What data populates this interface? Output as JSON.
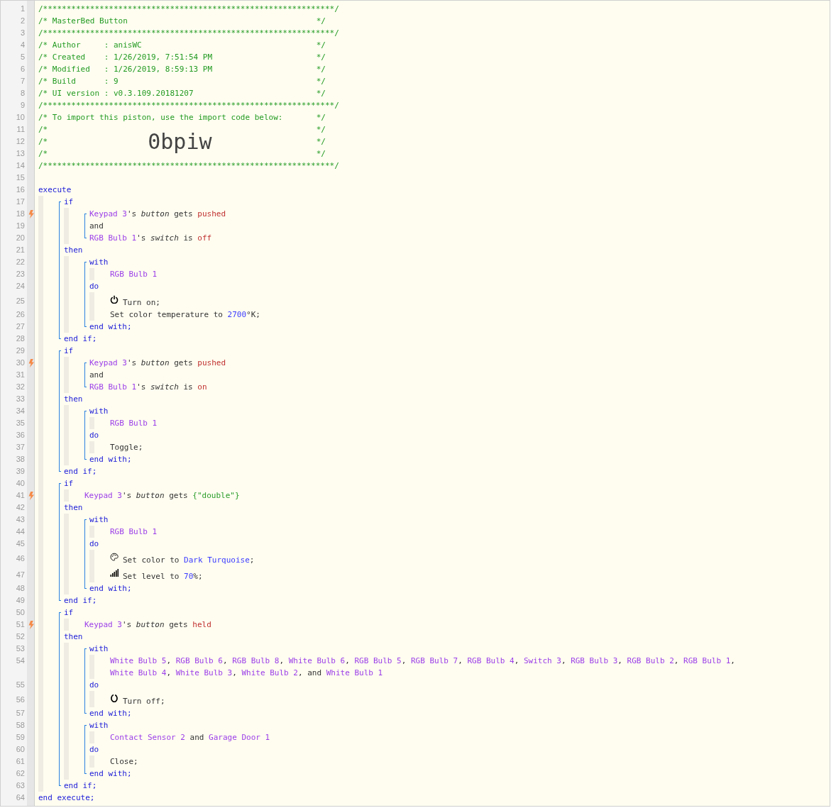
{
  "lines": [
    {
      "kind": "line",
      "number": "1",
      "trigger": false,
      "segments": [
        {
          "kind": "comment",
          "text": "/**************************************************************/"
        }
      ]
    },
    {
      "kind": "line",
      "number": "2",
      "trigger": false,
      "segments": [
        {
          "kind": "comment",
          "text": "/* MasterBed Button"
        },
        {
          "kind": "comment-end",
          "text": "*/"
        }
      ]
    },
    {
      "kind": "line",
      "number": "3",
      "trigger": false,
      "segments": [
        {
          "kind": "comment",
          "text": "/**************************************************************/"
        }
      ]
    },
    {
      "kind": "line",
      "number": "4",
      "trigger": false,
      "segments": [
        {
          "kind": "comment",
          "text": "/* Author     : anisWC"
        },
        {
          "kind": "comment-end",
          "text": "*/"
        }
      ]
    },
    {
      "kind": "line",
      "number": "5",
      "trigger": false,
      "segments": [
        {
          "kind": "comment",
          "text": "/* Created    : 1/26/2019, 7:51:54 PM"
        },
        {
          "kind": "comment-end",
          "text": "*/"
        }
      ]
    },
    {
      "kind": "line",
      "number": "6",
      "trigger": false,
      "segments": [
        {
          "kind": "comment",
          "text": "/* Modified   : 1/26/2019, 8:59:13 PM"
        },
        {
          "kind": "comment-end",
          "text": "*/"
        }
      ]
    },
    {
      "kind": "line",
      "number": "7",
      "trigger": false,
      "segments": [
        {
          "kind": "comment",
          "text": "/* Build      : 9"
        },
        {
          "kind": "comment-end",
          "text": "*/"
        }
      ]
    },
    {
      "kind": "line",
      "number": "8",
      "trigger": false,
      "segments": [
        {
          "kind": "comment",
          "text": "/* UI version : v0.3.109.20181207"
        },
        {
          "kind": "comment-end",
          "text": "*/"
        }
      ]
    },
    {
      "kind": "line",
      "number": "9",
      "trigger": false,
      "segments": [
        {
          "kind": "comment",
          "text": "/**************************************************************/"
        }
      ]
    },
    {
      "kind": "line",
      "number": "10",
      "trigger": false,
      "segments": [
        {
          "kind": "comment",
          "text": "/* To import this piston, use the import code below:"
        },
        {
          "kind": "comment-end",
          "text": "*/"
        }
      ]
    },
    {
      "kind": "line",
      "number": "11",
      "trigger": false,
      "segments": [
        {
          "kind": "comment",
          "text": "/*"
        },
        {
          "kind": "comment-end",
          "text": "*/"
        }
      ]
    },
    {
      "kind": "line",
      "number": "12",
      "trigger": false,
      "segments": [
        {
          "kind": "comment",
          "text": "/*"
        },
        {
          "kind": "import-code",
          "text": "0bpiw"
        },
        {
          "kind": "comment-end",
          "text": "*/"
        }
      ]
    },
    {
      "kind": "line",
      "number": "13",
      "trigger": false,
      "segments": [
        {
          "kind": "comment",
          "text": "/*"
        },
        {
          "kind": "comment-end",
          "text": "*/"
        }
      ]
    },
    {
      "kind": "line",
      "number": "14",
      "trigger": false,
      "segments": [
        {
          "kind": "comment",
          "text": "/**************************************************************/"
        }
      ]
    },
    {
      "kind": "line",
      "number": "15",
      "trigger": false
    },
    {
      "kind": "line",
      "number": "16",
      "trigger": false,
      "segments": [
        {
          "kind": "keyword",
          "text": "execute"
        }
      ],
      "children": [
        {
          "kind": "group",
          "items": [
            {
              "kind": "line",
              "number": "17",
              "trigger": false,
              "segments": [
                {
                  "kind": "keyword",
                  "text": "if"
                }
              ],
              "children": [
                {
                  "kind": "group",
                  "items": [
                    {
                      "kind": "line",
                      "number": "18",
                      "trigger": true,
                      "segments": [
                        {
                          "kind": "device",
                          "text": "Keypad 3"
                        },
                        {
                          "kind": "plain",
                          "text": "'s "
                        },
                        {
                          "kind": "property",
                          "text": "button"
                        },
                        {
                          "kind": "plain",
                          "text": " gets "
                        },
                        {
                          "kind": "value",
                          "text": "pushed"
                        }
                      ]
                    },
                    {
                      "kind": "line",
                      "number": "19",
                      "trigger": false,
                      "segments": [
                        {
                          "kind": "plain",
                          "text": "and"
                        }
                      ]
                    },
                    {
                      "kind": "line",
                      "number": "20",
                      "trigger": false,
                      "segments": [
                        {
                          "kind": "device",
                          "text": "RGB Bulb 1"
                        },
                        {
                          "kind": "plain",
                          "text": "'s "
                        },
                        {
                          "kind": "property",
                          "text": "switch"
                        },
                        {
                          "kind": "plain",
                          "text": " is "
                        },
                        {
                          "kind": "value",
                          "text": "off"
                        }
                      ]
                    }
                  ]
                }
              ]
            },
            {
              "kind": "line",
              "number": "21",
              "trigger": false,
              "segments": [
                {
                  "kind": "keyword",
                  "text": "then"
                }
              ],
              "children": [
                {
                  "kind": "group",
                  "items": [
                    {
                      "kind": "line",
                      "number": "22",
                      "trigger": false,
                      "segments": [
                        {
                          "kind": "keyword",
                          "text": "with"
                        }
                      ],
                      "children": [
                        {
                          "kind": "line",
                          "number": "23",
                          "trigger": false,
                          "segments": [
                            {
                              "kind": "device",
                              "text": "RGB Bulb 1"
                            }
                          ]
                        }
                      ]
                    },
                    {
                      "kind": "line",
                      "number": "24",
                      "trigger": false,
                      "segments": [
                        {
                          "kind": "keyword",
                          "text": "do"
                        }
                      ],
                      "children": [
                        {
                          "kind": "line",
                          "number": "25",
                          "trigger": false,
                          "segments": [
                            {
                              "kind": "power"
                            },
                            {
                              "kind": "plain",
                              "text": "Turn on;"
                            }
                          ]
                        },
                        {
                          "kind": "line",
                          "number": "26",
                          "trigger": false,
                          "segments": [
                            {
                              "kind": "plain",
                              "text": "Set color temperature to "
                            },
                            {
                              "kind": "number",
                              "text": "2700"
                            },
                            {
                              "kind": "plain",
                              "text": "°K;"
                            }
                          ]
                        }
                      ]
                    },
                    {
                      "kind": "line",
                      "number": "27",
                      "trigger": false,
                      "segments": [
                        {
                          "kind": "keyword",
                          "text": "end with;"
                        }
                      ]
                    }
                  ]
                }
              ]
            },
            {
              "kind": "line",
              "number": "28",
              "trigger": false,
              "segments": [
                {
                  "kind": "keyword",
                  "text": "end if;"
                }
              ]
            }
          ]
        },
        {
          "kind": "group",
          "items": [
            {
              "kind": "line",
              "number": "29",
              "trigger": false,
              "segments": [
                {
                  "kind": "keyword",
                  "text": "if"
                }
              ],
              "children": [
                {
                  "kind": "group",
                  "items": [
                    {
                      "kind": "line",
                      "number": "30",
                      "trigger": true,
                      "segments": [
                        {
                          "kind": "device",
                          "text": "Keypad 3"
                        },
                        {
                          "kind": "plain",
                          "text": "'s "
                        },
                        {
                          "kind": "property",
                          "text": "button"
                        },
                        {
                          "kind": "plain",
                          "text": " gets "
                        },
                        {
                          "kind": "value",
                          "text": "pushed"
                        }
                      ]
                    },
                    {
                      "kind": "line",
                      "number": "31",
                      "trigger": false,
                      "segments": [
                        {
                          "kind": "plain",
                          "text": "and"
                        }
                      ]
                    },
                    {
                      "kind": "line",
                      "number": "32",
                      "trigger": false,
                      "segments": [
                        {
                          "kind": "device",
                          "text": "RGB Bulb 1"
                        },
                        {
                          "kind": "plain",
                          "text": "'s "
                        },
                        {
                          "kind": "property",
                          "text": "switch"
                        },
                        {
                          "kind": "plain",
                          "text": " is "
                        },
                        {
                          "kind": "value",
                          "text": "on"
                        }
                      ]
                    }
                  ]
                }
              ]
            },
            {
              "kind": "line",
              "number": "33",
              "trigger": false,
              "segments": [
                {
                  "kind": "keyword",
                  "text": "then"
                }
              ],
              "children": [
                {
                  "kind": "group",
                  "items": [
                    {
                      "kind": "line",
                      "number": "34",
                      "trigger": false,
                      "segments": [
                        {
                          "kind": "keyword",
                          "text": "with"
                        }
                      ],
                      "children": [
                        {
                          "kind": "line",
                          "number": "35",
                          "trigger": false,
                          "segments": [
                            {
                              "kind": "device",
                              "text": "RGB Bulb 1"
                            }
                          ]
                        }
                      ]
                    },
                    {
                      "kind": "line",
                      "number": "36",
                      "trigger": false,
                      "segments": [
                        {
                          "kind": "keyword",
                          "text": "do"
                        }
                      ],
                      "children": [
                        {
                          "kind": "line",
                          "number": "37",
                          "trigger": false,
                          "segments": [
                            {
                              "kind": "plain",
                              "text": "Toggle;"
                            }
                          ]
                        }
                      ]
                    },
                    {
                      "kind": "line",
                      "number": "38",
                      "trigger": false,
                      "segments": [
                        {
                          "kind": "keyword",
                          "text": "end with;"
                        }
                      ]
                    }
                  ]
                }
              ]
            },
            {
              "kind": "line",
              "number": "39",
              "trigger": false,
              "segments": [
                {
                  "kind": "keyword",
                  "text": "end if;"
                }
              ]
            }
          ]
        },
        {
          "kind": "group",
          "items": [
            {
              "kind": "line",
              "number": "40",
              "trigger": false,
              "segments": [
                {
                  "kind": "keyword",
                  "text": "if"
                }
              ],
              "children": [
                {
                  "kind": "line",
                  "number": "41",
                  "trigger": true,
                  "segments": [
                    {
                      "kind": "device",
                      "text": "Keypad 3"
                    },
                    {
                      "kind": "plain",
                      "text": "'s "
                    },
                    {
                      "kind": "property",
                      "text": "button"
                    },
                    {
                      "kind": "plain",
                      "text": " gets "
                    },
                    {
                      "kind": "string",
                      "text": "{\"double\"}"
                    }
                  ]
                }
              ]
            },
            {
              "kind": "line",
              "number": "42",
              "trigger": false,
              "segments": [
                {
                  "kind": "keyword",
                  "text": "then"
                }
              ],
              "children": [
                {
                  "kind": "group",
                  "items": [
                    {
                      "kind": "line",
                      "number": "43",
                      "trigger": false,
                      "segments": [
                        {
                          "kind": "keyword",
                          "text": "with"
                        }
                      ],
                      "children": [
                        {
                          "kind": "line",
                          "number": "44",
                          "trigger": false,
                          "segments": [
                            {
                              "kind": "device",
                              "text": "RGB Bulb 1"
                            }
                          ]
                        }
                      ]
                    },
                    {
                      "kind": "line",
                      "number": "45",
                      "trigger": false,
                      "segments": [
                        {
                          "kind": "keyword",
                          "text": "do"
                        }
                      ],
                      "children": [
                        {
                          "kind": "line",
                          "number": "46",
                          "trigger": false,
                          "segments": [
                            {
                              "kind": "palette"
                            },
                            {
                              "kind": "plain",
                              "text": "Set color to "
                            },
                            {
                              "kind": "number",
                              "text": "Dark Turquoise"
                            },
                            {
                              "kind": "plain",
                              "text": ";"
                            }
                          ]
                        },
                        {
                          "kind": "line",
                          "number": "47",
                          "trigger": false,
                          "segments": [
                            {
                              "kind": "level"
                            },
                            {
                              "kind": "plain",
                              "text": "Set level to "
                            },
                            {
                              "kind": "number",
                              "text": "70"
                            },
                            {
                              "kind": "plain",
                              "text": "%;"
                            }
                          ]
                        }
                      ]
                    },
                    {
                      "kind": "line",
                      "number": "48",
                      "trigger": false,
                      "segments": [
                        {
                          "kind": "keyword",
                          "text": "end with;"
                        }
                      ]
                    }
                  ]
                }
              ]
            },
            {
              "kind": "line",
              "number": "49",
              "trigger": false,
              "segments": [
                {
                  "kind": "keyword",
                  "text": "end if;"
                }
              ]
            }
          ]
        },
        {
          "kind": "group",
          "items": [
            {
              "kind": "line",
              "number": "50",
              "trigger": false,
              "segments": [
                {
                  "kind": "keyword",
                  "text": "if"
                }
              ],
              "children": [
                {
                  "kind": "line",
                  "number": "51",
                  "trigger": true,
                  "segments": [
                    {
                      "kind": "device",
                      "text": "Keypad 3"
                    },
                    {
                      "kind": "plain",
                      "text": "'s "
                    },
                    {
                      "kind": "property",
                      "text": "button"
                    },
                    {
                      "kind": "plain",
                      "text": " gets "
                    },
                    {
                      "kind": "value",
                      "text": "held"
                    }
                  ]
                }
              ]
            },
            {
              "kind": "line",
              "number": "52",
              "trigger": false,
              "segments": [
                {
                  "kind": "keyword",
                  "text": "then"
                }
              ],
              "children": [
                {
                  "kind": "group",
                  "items": [
                    {
                      "kind": "line",
                      "number": "53",
                      "trigger": false,
                      "segments": [
                        {
                          "kind": "keyword",
                          "text": "with"
                        }
                      ],
                      "children": [
                        {
                          "kind": "line",
                          "number": "54",
                          "trigger": false,
                          "segments": [
                            {
                              "kind": "device",
                              "text": "White Bulb 5"
                            },
                            {
                              "kind": "plain",
                              "text": ", "
                            },
                            {
                              "kind": "device",
                              "text": "RGB Bulb 6"
                            },
                            {
                              "kind": "plain",
                              "text": ", "
                            },
                            {
                              "kind": "device",
                              "text": "RGB Bulb 8"
                            },
                            {
                              "kind": "plain",
                              "text": ", "
                            },
                            {
                              "kind": "device",
                              "text": "White Bulb 6"
                            },
                            {
                              "kind": "plain",
                              "text": ", "
                            },
                            {
                              "kind": "device",
                              "text": "RGB Bulb 5"
                            },
                            {
                              "kind": "plain",
                              "text": ", "
                            },
                            {
                              "kind": "device",
                              "text": "RGB Bulb 7"
                            },
                            {
                              "kind": "plain",
                              "text": ", "
                            },
                            {
                              "kind": "device",
                              "text": "RGB Bulb 4"
                            },
                            {
                              "kind": "plain",
                              "text": ", "
                            },
                            {
                              "kind": "device",
                              "text": "Switch 3"
                            },
                            {
                              "kind": "plain",
                              "text": ", "
                            },
                            {
                              "kind": "device",
                              "text": "RGB Bulb 3"
                            },
                            {
                              "kind": "plain",
                              "text": ", "
                            },
                            {
                              "kind": "device",
                              "text": "RGB Bulb 2"
                            },
                            {
                              "kind": "plain",
                              "text": ", "
                            },
                            {
                              "kind": "device",
                              "text": "RGB Bulb 1"
                            },
                            {
                              "kind": "plain",
                              "text": ", "
                            },
                            {
                              "kind": "device",
                              "text": "White Bulb 4"
                            },
                            {
                              "kind": "plain",
                              "text": ", "
                            },
                            {
                              "kind": "device",
                              "text": "White Bulb 3"
                            },
                            {
                              "kind": "plain",
                              "text": ", "
                            },
                            {
                              "kind": "device",
                              "text": "White Bulb 2"
                            },
                            {
                              "kind": "plain",
                              "text": ", and "
                            },
                            {
                              "kind": "device",
                              "text": "White Bulb 1"
                            }
                          ]
                        }
                      ]
                    },
                    {
                      "kind": "line",
                      "number": "55",
                      "trigger": false,
                      "segments": [
                        {
                          "kind": "keyword",
                          "text": "do"
                        }
                      ],
                      "children": [
                        {
                          "kind": "line",
                          "number": "56",
                          "trigger": false,
                          "segments": [
                            {
                              "kind": "ring"
                            },
                            {
                              "kind": "plain",
                              "text": "Turn off;"
                            }
                          ]
                        }
                      ]
                    },
                    {
                      "kind": "line",
                      "number": "57",
                      "trigger": false,
                      "segments": [
                        {
                          "kind": "keyword",
                          "text": "end with;"
                        }
                      ]
                    }
                  ]
                },
                {
                  "kind": "group",
                  "items": [
                    {
                      "kind": "line",
                      "number": "58",
                      "trigger": false,
                      "segments": [
                        {
                          "kind": "keyword",
                          "text": "with"
                        }
                      ],
                      "children": [
                        {
                          "kind": "line",
                          "number": "59",
                          "trigger": false,
                          "segments": [
                            {
                              "kind": "device",
                              "text": "Contact Sensor 2"
                            },
                            {
                              "kind": "plain",
                              "text": " and "
                            },
                            {
                              "kind": "device",
                              "text": "Garage Door 1"
                            }
                          ]
                        }
                      ]
                    },
                    {
                      "kind": "line",
                      "number": "60",
                      "trigger": false,
                      "segments": [
                        {
                          "kind": "keyword",
                          "text": "do"
                        }
                      ],
                      "children": [
                        {
                          "kind": "line",
                          "number": "61",
                          "trigger": false,
                          "segments": [
                            {
                              "kind": "plain",
                              "text": "Close;"
                            }
                          ]
                        }
                      ]
                    },
                    {
                      "kind": "line",
                      "number": "62",
                      "trigger": false,
                      "segments": [
                        {
                          "kind": "keyword",
                          "text": "end with;"
                        }
                      ]
                    }
                  ]
                }
              ]
            },
            {
              "kind": "line",
              "number": "63",
              "trigger": false,
              "segments": [
                {
                  "kind": "keyword",
                  "text": "end if;"
                }
              ]
            }
          ]
        }
      ]
    },
    {
      "kind": "line",
      "number": "64",
      "trigger": false,
      "segments": [
        {
          "kind": "keyword",
          "text": "end execute;"
        }
      ]
    }
  ]
}
